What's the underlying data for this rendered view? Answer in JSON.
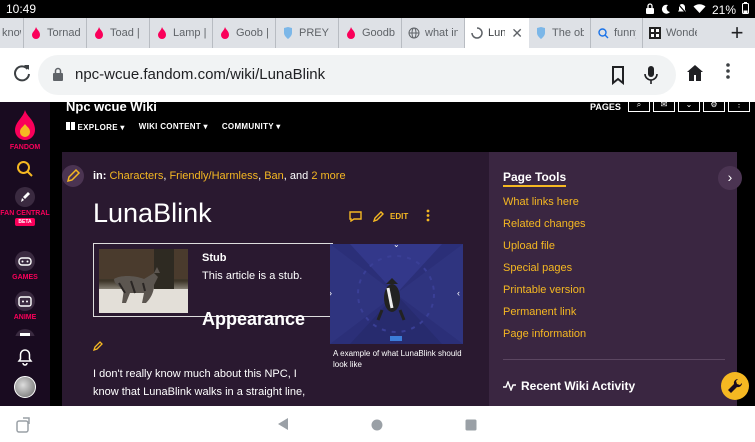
{
  "status": {
    "time": "10:49",
    "battery": "21%"
  },
  "tabs": [
    {
      "label": "know"
    },
    {
      "label": "Tornad"
    },
    {
      "label": "Toad | "
    },
    {
      "label": "Lamp | "
    },
    {
      "label": "Goob | "
    },
    {
      "label": "PREY U"
    },
    {
      "label": "Goodby"
    },
    {
      "label": "what in"
    },
    {
      "label": "Lun",
      "active": true
    },
    {
      "label": "The ob"
    },
    {
      "label": "funny c"
    },
    {
      "label": "Wonde"
    }
  ],
  "browser": {
    "url": "npc-wcue.fandom.com/wiki/LunaBlink"
  },
  "rail": {
    "fandom": "FANDOM",
    "fan_central": "FAN CENTRAL",
    "beta": "BETA",
    "games": "GAMES",
    "anime": "ANIME"
  },
  "wiki": {
    "name": "Npc wcue Wiki",
    "nav": {
      "explore": "EXPLORE",
      "wiki_content": "WIKI CONTENT",
      "community": "COMMUNITY"
    },
    "pages": "PAGES"
  },
  "article": {
    "cats_prefix": "in:",
    "categories": [
      "Characters",
      "Friendly/Harmless",
      "Ban"
    ],
    "cats_and": "and",
    "cats_more": "2 more",
    "title": "LunaBlink",
    "edit": "EDIT",
    "stub_title": "Stub",
    "stub_text": "This article is a stub.",
    "section": "Appearance",
    "paragraph": "I don't really know much about this NPC, I know that LunaBlink walks in a straight line,",
    "caption": "A example of what LunaBlink should look like"
  },
  "page_tools": {
    "title": "Page Tools",
    "links": [
      "What links here",
      "Related changes",
      "Upload file",
      "Special pages",
      "Printable version",
      "Permanent link",
      "Page information"
    ],
    "recent": "Recent Wiki Activity"
  },
  "colors": {
    "accent": "#f5b822",
    "brand": "#fa005a",
    "panel": "#3a2641",
    "article_bg": "#2a1930"
  }
}
